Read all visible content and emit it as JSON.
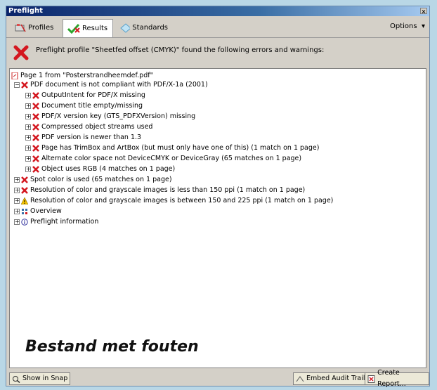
{
  "window": {
    "title": "Preflight",
    "close_glyph": "×"
  },
  "tabs": [
    {
      "label": "Profiles",
      "icon": "profiles-icon"
    },
    {
      "label": "Results",
      "icon": "checkmark-icon"
    },
    {
      "label": "Standards",
      "icon": "standards-icon"
    }
  ],
  "options_label": "Options",
  "header": {
    "message": "Preflight profile \"Sheetfed offset (CMYK)\" found the following errors and warnings:"
  },
  "tree": [
    {
      "label": "Page 1 from \"Posterstrandheemdef.pdf\"",
      "icon": "pdf-page-icon"
    },
    {
      "label": "PDF document is not compliant with PDF/X-1a (2001)",
      "icon": "error-icon"
    },
    {
      "label": "OutputIntent for PDF/X missing",
      "icon": "error-icon"
    },
    {
      "label": "Document title empty/missing",
      "icon": "error-icon"
    },
    {
      "label": "PDF/X version key (GTS_PDFXVersion) missing",
      "icon": "error-icon"
    },
    {
      "label": "Compressed object streams used",
      "icon": "error-icon"
    },
    {
      "label": "PDF version is newer than 1.3",
      "icon": "error-icon"
    },
    {
      "label": "Page has TrimBox and ArtBox (but must only have one of this) (1 match on 1 page)",
      "icon": "error-icon"
    },
    {
      "label": "Alternate color space not DeviceCMYK or DeviceGray (65 matches on 1 page)",
      "icon": "error-icon"
    },
    {
      "label": "Object uses RGB (4 matches on 1 page)",
      "icon": "error-icon"
    },
    {
      "label": "Spot color is used (65 matches on 1 page)",
      "icon": "error-icon"
    },
    {
      "label": "Resolution of color and grayscale images is less than 150 ppi (1 match on 1 page)",
      "icon": "error-icon"
    },
    {
      "label": "Resolution of color and grayscale images is between 150 and 225 ppi (1 match on 1 page)",
      "icon": "warning-icon"
    },
    {
      "label": "Overview",
      "icon": "overview-icon"
    },
    {
      "label": "Preflight information",
      "icon": "info-icon"
    }
  ],
  "overlay_caption": "Bestand met fouten",
  "buttons": {
    "show_in_snap": "Show in Snap",
    "embed_audit_trail": "Embed Audit Trail...",
    "create_report": "Create Report..."
  },
  "colors": {
    "error": "#d4171f",
    "warning": "#f2c200",
    "title_bar": "#0a246a",
    "success": "#2ea52e"
  }
}
